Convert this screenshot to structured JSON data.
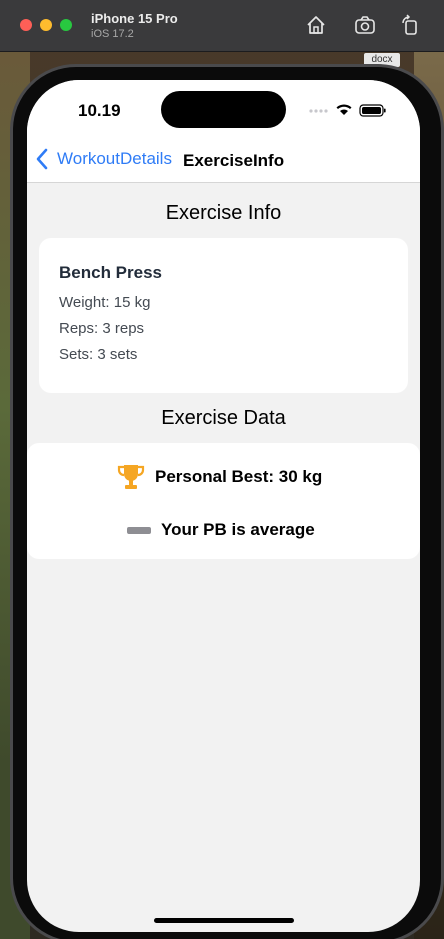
{
  "simulator": {
    "device_name": "iPhone 15 Pro",
    "os_version": "iOS 17.2",
    "background_file_chip": "docx"
  },
  "status_bar": {
    "time": "10.19"
  },
  "navigation": {
    "back_label": "WorkoutDetails",
    "title": "ExerciseInfo"
  },
  "exercise_info": {
    "section_title": "Exercise Info",
    "name": "Bench Press",
    "weight": "Weight: 15 kg",
    "reps": "Reps: 3 reps",
    "sets": "Sets: 3 sets"
  },
  "exercise_data": {
    "section_title": "Exercise Data",
    "personal_best": "Personal Best: 30 kg",
    "pb_rating": "Your PB is average"
  },
  "colors": {
    "accent": "#2f7cf6",
    "trophy": "#f5a623",
    "neutral_indicator": "#8e8e93",
    "background": "#f2f2f2"
  },
  "icons": [
    "home-icon",
    "screenshot-icon",
    "rotate-icon",
    "chevron-left-icon",
    "wifi-icon",
    "battery-icon",
    "trophy-icon",
    "minus-icon"
  ]
}
